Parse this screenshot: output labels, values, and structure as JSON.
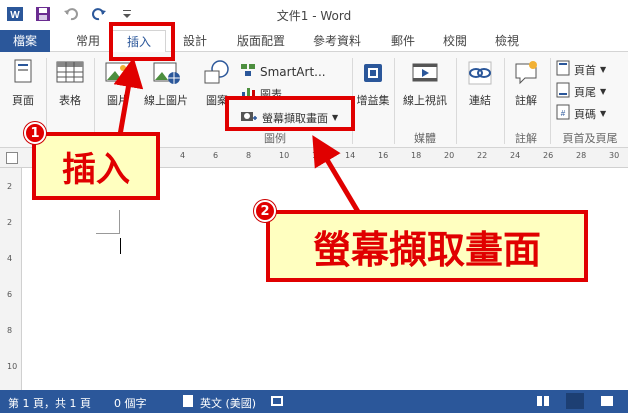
{
  "window": {
    "title": "文件1 - Word",
    "qat": {
      "word_icon": "word-icon",
      "save_icon": "save-icon",
      "undo_icon": "undo-icon",
      "redo_icon": "redo-icon",
      "customize_icon": "customize-qat-icon"
    }
  },
  "tabs": [
    {
      "label": "檔案"
    },
    {
      "label": "常用"
    },
    {
      "label": "插入"
    },
    {
      "label": "設計"
    },
    {
      "label": "版面配置"
    },
    {
      "label": "參考資料"
    },
    {
      "label": "郵件"
    },
    {
      "label": "校閱"
    },
    {
      "label": "檢視"
    }
  ],
  "ribbon": {
    "page": "頁面",
    "table": "表格",
    "picture": "圖片",
    "online_picture": "線上圖片",
    "shapes": "圖案",
    "smartart": "SmartArt...",
    "chart": "圖表",
    "screenshot": "螢幕擷取畫面",
    "addins": "增益集",
    "online_video": "線上視訊",
    "link": "連結",
    "comment": "註解",
    "header": "頁首",
    "footer": "頁尾",
    "page_number": "頁碼",
    "groups": {
      "illustrations": "圖例",
      "media": "媒體",
      "comments": "註解",
      "header_footer": "頁首及頁尾"
    }
  },
  "ruler": {
    "h_marks": [
      "4",
      "6",
      "8",
      "10",
      "12",
      "14",
      "16",
      "18",
      "20",
      "22",
      "24",
      "26",
      "28",
      "30"
    ],
    "v_marks": [
      "2",
      "2",
      "4",
      "6",
      "8",
      "10"
    ]
  },
  "status": {
    "page": "第 1 頁，共 1 頁",
    "words": "0 個字",
    "language": "英文 (美國)"
  },
  "annotations": {
    "step1_number": "1",
    "step1_text": "插入",
    "step2_number": "2",
    "step2_text": "螢幕擷取畫面"
  },
  "colors": {
    "accent": "#2b579a",
    "annotation": "#e00000",
    "callout_bg": "#ffffc0"
  }
}
